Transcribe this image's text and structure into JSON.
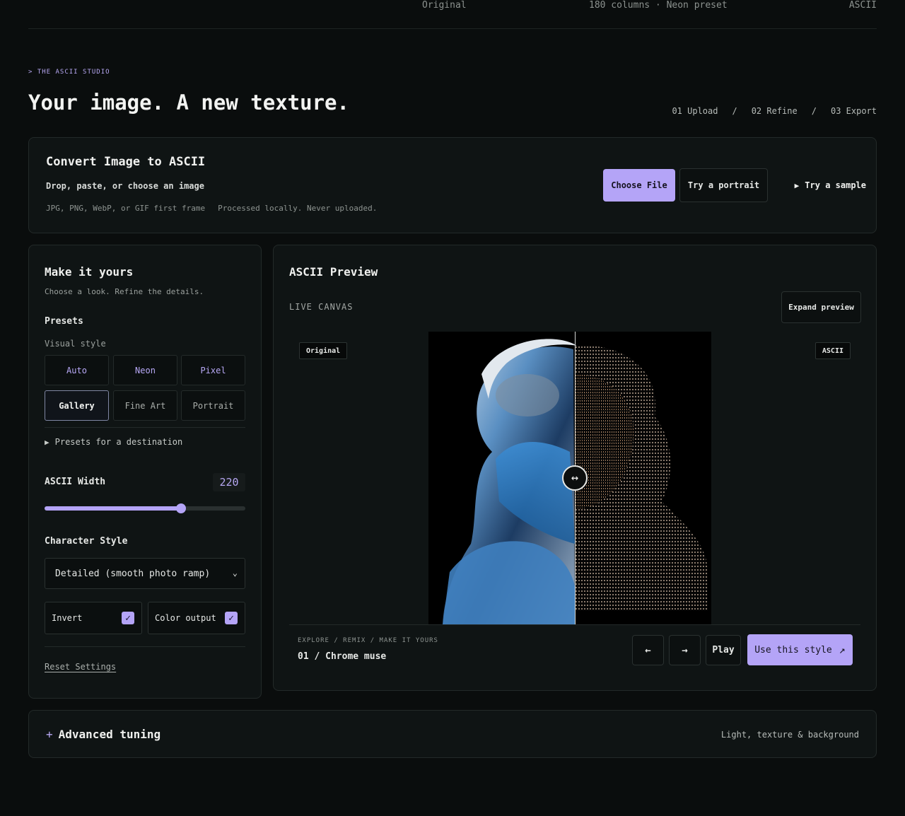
{
  "topbar": {
    "original": "Original",
    "center": "180 columns · Neon preset",
    "right": "ASCII"
  },
  "hero": {
    "eyebrow": "> THE ASCII STUDIO",
    "title": "Your image. A new texture.",
    "steps": [
      "01 Upload",
      "/",
      "02 Refine",
      "/",
      "03 Export"
    ]
  },
  "upload": {
    "title": "Convert Image to ASCII",
    "subtitle": "Drop, paste, or choose an image",
    "formats": "JPG, PNG, WebP, or GIF first frame",
    "privacy": "Processed locally. Never uploaded.",
    "choose_label": "Choose File",
    "portrait_label": "Try a portrait",
    "sample_label": "Try a sample",
    "sample_icon": "play-icon"
  },
  "controls": {
    "title": "Make it yours",
    "subtitle": "Choose a look. Refine the details.",
    "presets_label": "Presets",
    "visual_style_label": "Visual style",
    "presets": [
      "Auto",
      "Neon",
      "Pixel",
      "Gallery",
      "Fine Art",
      "Portrait"
    ],
    "selected_preset": "Gallery",
    "destination_label": "Presets for a destination",
    "width_label": "ASCII Width",
    "width_value": "220",
    "width_fraction": 0.68,
    "char_style_label": "Character Style",
    "char_style_value": "Detailed (smooth photo ramp)",
    "invert_label": "Invert",
    "color_output_label": "Color output",
    "reset_label": "Reset Settings"
  },
  "preview": {
    "title": "ASCII Preview",
    "live_label": "LIVE CANVAS",
    "expand_label": "Expand preview",
    "original_tag": "Original",
    "ascii_tag": "ASCII",
    "crumb": "EXPLORE / REMIX / MAKE IT YOURS",
    "slide_title": "01 / Chrome muse",
    "prev_label": "←",
    "next_label": "→",
    "play_label": "Play",
    "use_label": "Use this style",
    "use_icon": "↗"
  },
  "advanced": {
    "plus": "+",
    "title": "Advanced tuning",
    "hint": "Light, texture & background"
  },
  "colors": {
    "accent": "#b4a4f7",
    "background": "#0a0d0d",
    "card": "#0f1414"
  }
}
